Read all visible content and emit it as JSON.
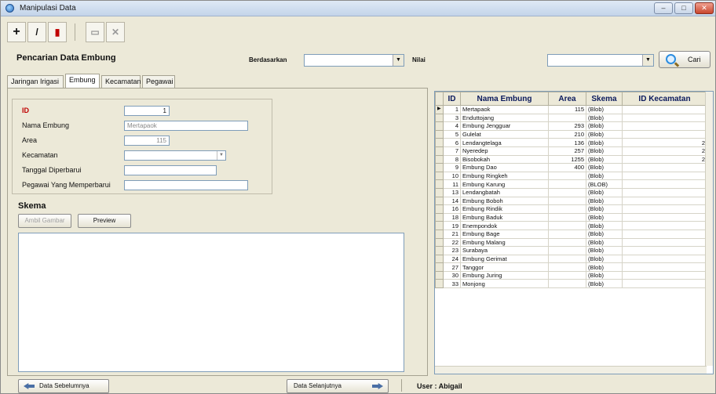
{
  "window": {
    "title": "Manipulasi Data",
    "controls": {
      "minimize": "–",
      "maximize": "□",
      "close": "✕"
    }
  },
  "toolbar": {
    "icons": [
      "add-icon",
      "edit-icon",
      "delete-icon",
      "save-icon",
      "cancel-icon"
    ],
    "glyphs": {
      "add": "+",
      "edit": "/",
      "delete": "▮",
      "save": "▭",
      "cancel": "✕"
    }
  },
  "search": {
    "title": "Pencarian Data Embung",
    "berdasarkan_label": "Berdasarkan",
    "berdasarkan_value": "",
    "nilai_label": "Nilai",
    "nilai_value": "",
    "cari_label": "Cari"
  },
  "tabs": [
    {
      "label": "Jaringan Irigasi"
    },
    {
      "label": "Embung"
    },
    {
      "label": "Kecamatan"
    },
    {
      "label": "Pegawai"
    }
  ],
  "form": {
    "id_label": "ID",
    "id_value": "1",
    "nama_label": "Nama Embung",
    "nama_value": "Mertapaok",
    "area_label": "Area",
    "area_value": "115",
    "kecamatan_label": "Kecamatan",
    "kecamatan_value": "",
    "tanggal_label": "Tanggal Diperbarui",
    "tanggal_value": "",
    "pegawai_label": "Pegawai Yang Memperbarui",
    "pegawai_value": ""
  },
  "skema": {
    "title": "Skema",
    "ambil_label": "Ambil Gambar",
    "preview_label": "Preview"
  },
  "grid": {
    "headers": [
      "ID",
      "Nama Embung",
      "Area",
      "Skema",
      "ID Kecamatan"
    ],
    "rows": [
      {
        "id": "1",
        "nama": "Mertapaok",
        "area": "115",
        "skema": "(Blob)",
        "kec": ""
      },
      {
        "id": "3",
        "nama": "Enduttojang",
        "area": "",
        "skema": "(Blob)",
        "kec": ""
      },
      {
        "id": "4",
        "nama": "Embung Jengguar",
        "area": "293",
        "skema": "(Blob)",
        "kec": ""
      },
      {
        "id": "5",
        "nama": "Gulelat",
        "area": "210",
        "skema": "(Blob)",
        "kec": ""
      },
      {
        "id": "6",
        "nama": "Lendangtelaga",
        "area": "136",
        "skema": "(Blob)",
        "kec": "2"
      },
      {
        "id": "7",
        "nama": "Nyeredep",
        "area": "257",
        "skema": "(Blob)",
        "kec": "2"
      },
      {
        "id": "8",
        "nama": "Bisobokah",
        "area": "1255",
        "skema": "(Blob)",
        "kec": "2"
      },
      {
        "id": "9",
        "nama": "Embung Dao",
        "area": "400",
        "skema": "(Blob)",
        "kec": ""
      },
      {
        "id": "10",
        "nama": "Embung Ringkeh",
        "area": "",
        "skema": "(Blob)",
        "kec": ""
      },
      {
        "id": "11",
        "nama": "Embung Karung",
        "area": "",
        "skema": "(BLOB)",
        "kec": ""
      },
      {
        "id": "13",
        "nama": "Lendangbatah",
        "area": "",
        "skema": "(Blob)",
        "kec": ""
      },
      {
        "id": "14",
        "nama": "Embung Boboh",
        "area": "",
        "skema": "(Blob)",
        "kec": ""
      },
      {
        "id": "16",
        "nama": "Embung Rindik",
        "area": "",
        "skema": "(Blob)",
        "kec": ""
      },
      {
        "id": "18",
        "nama": "Embung Baduk",
        "area": "",
        "skema": "(Blob)",
        "kec": ""
      },
      {
        "id": "19",
        "nama": "Enempondok",
        "area": "",
        "skema": "(Blob)",
        "kec": ""
      },
      {
        "id": "21",
        "nama": "Embung Bage",
        "area": "",
        "skema": "(Blob)",
        "kec": ""
      },
      {
        "id": "22",
        "nama": "Embung Malang",
        "area": "",
        "skema": "(Blob)",
        "kec": ""
      },
      {
        "id": "23",
        "nama": "Surabaya",
        "area": "",
        "skema": "(Blob)",
        "kec": ""
      },
      {
        "id": "24",
        "nama": "Embung Gerimat",
        "area": "",
        "skema": "(Blob)",
        "kec": ""
      },
      {
        "id": "27",
        "nama": "Tanggor",
        "area": "",
        "skema": "(Blob)",
        "kec": ""
      },
      {
        "id": "30",
        "nama": "Embung Juring",
        "area": "",
        "skema": "(Blob)",
        "kec": ""
      },
      {
        "id": "33",
        "nama": "Monjong",
        "area": "",
        "skema": "(Blob)",
        "kec": ""
      }
    ]
  },
  "footer": {
    "prev_label": "Data Sebelumnya",
    "next_label": "Data Selanjutnya",
    "user_label": "User : Abigail"
  },
  "colors": {
    "accent": "#2b8de0",
    "label_red": "#c00000"
  }
}
